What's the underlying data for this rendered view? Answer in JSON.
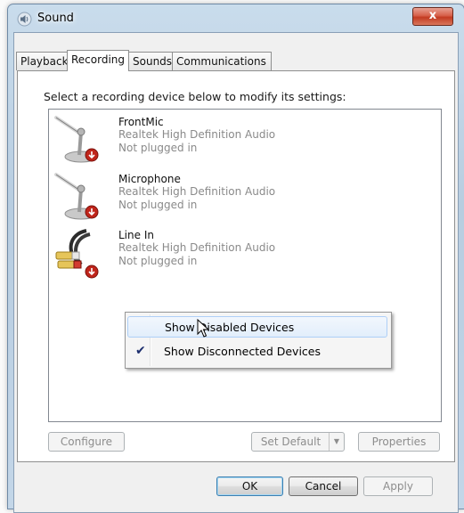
{
  "window": {
    "title": "Sound",
    "close_glyph": "x"
  },
  "tabs": [
    {
      "label": "Playback"
    },
    {
      "label": "Recording",
      "active": true
    },
    {
      "label": "Sounds"
    },
    {
      "label": "Communications"
    }
  ],
  "recording": {
    "instruction": "Select a recording device below to modify its settings:",
    "devices": [
      {
        "name": "FrontMic",
        "description": "Realtek High Definition Audio",
        "status": "Not plugged in",
        "icon": "microphone-icon"
      },
      {
        "name": "Microphone",
        "description": "Realtek High Definition Audio",
        "status": "Not plugged in",
        "icon": "microphone-icon"
      },
      {
        "name": "Line In",
        "description": "Realtek High Definition Audio",
        "status": "Not plugged in",
        "icon": "line-in-cable-icon"
      }
    ]
  },
  "context_menu": {
    "items": [
      {
        "label": "Show Disabled Devices",
        "checked": false,
        "hovered": true
      },
      {
        "label": "Show Disconnected Devices",
        "checked": true,
        "hovered": false
      }
    ]
  },
  "panel_buttons": {
    "configure": "Configure",
    "set_default": "Set Default",
    "properties": "Properties"
  },
  "dialog_buttons": {
    "ok": "OK",
    "cancel": "Cancel",
    "apply": "Apply"
  },
  "colors": {
    "status_arrow": "#c0251b",
    "checkmark": "#1c2e6e"
  }
}
